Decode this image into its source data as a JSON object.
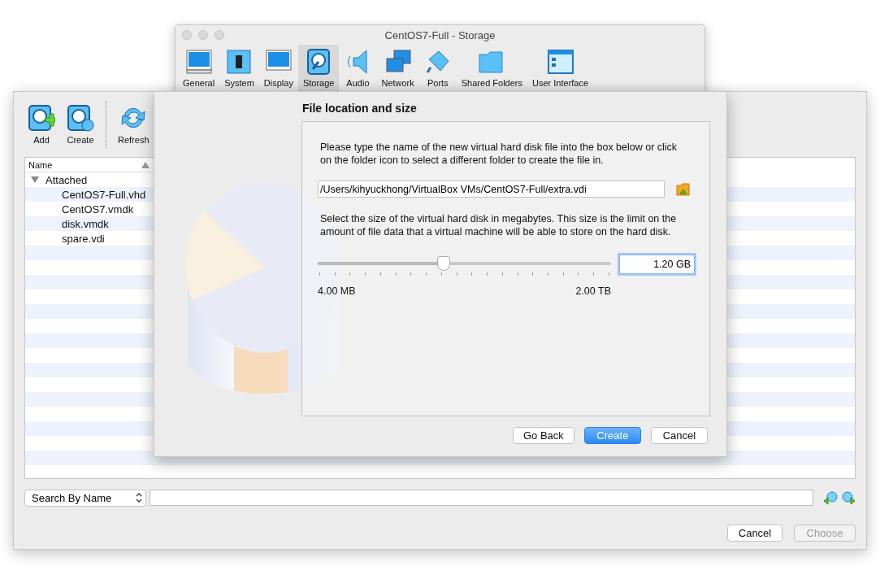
{
  "settings_window": {
    "title": "CentOS7-Full - Storage",
    "tabs": [
      {
        "label": "General",
        "selected": false
      },
      {
        "label": "System",
        "selected": false
      },
      {
        "label": "Display",
        "selected": false
      },
      {
        "label": "Storage",
        "selected": true
      },
      {
        "label": "Audio",
        "selected": false
      },
      {
        "label": "Network",
        "selected": false
      },
      {
        "label": "Ports",
        "selected": false
      },
      {
        "label": "Shared Folders",
        "selected": false
      },
      {
        "label": "User Interface",
        "selected": false
      }
    ]
  },
  "media_window": {
    "toolbar": [
      "Add",
      "Create",
      "Refresh"
    ],
    "list": {
      "column": "Name",
      "tree": [
        {
          "label": "Attached",
          "expanded": true,
          "children": [
            {
              "label": "CentOS7-Full.vhd"
            },
            {
              "label": "CentOS7.vmdk"
            },
            {
              "label": "disk.vmdk"
            },
            {
              "label": "spare.vdi"
            }
          ]
        }
      ]
    },
    "search": {
      "mode": "Search By Name"
    },
    "buttons": [
      {
        "label": "Cancel",
        "disabled": false
      },
      {
        "label": "Choose",
        "disabled": true
      }
    ]
  },
  "dialog": {
    "title": "File location and size",
    "intro": "Please type the name of the new virtual hard disk file into the box below or click on the folder icon to select a different folder to create the file in.",
    "path": "/Users/kihyuckhong/VirtualBox VMs/CentOS7-Full/extra.vdi",
    "size_text": "Select the size of the virtual hard disk in megabytes. This size is the limit on the amount of file data that a virtual machine will be able to store on the hard disk.",
    "slider": {
      "level": 0.43,
      "min_label": "4.00 MB",
      "max_label": "2.00 TB"
    },
    "size_value": "1.20 GB",
    "buttons": [
      {
        "label": "Go Back",
        "default": false
      },
      {
        "label": "Create",
        "default": true
      },
      {
        "label": "Cancel",
        "default": false
      }
    ]
  }
}
